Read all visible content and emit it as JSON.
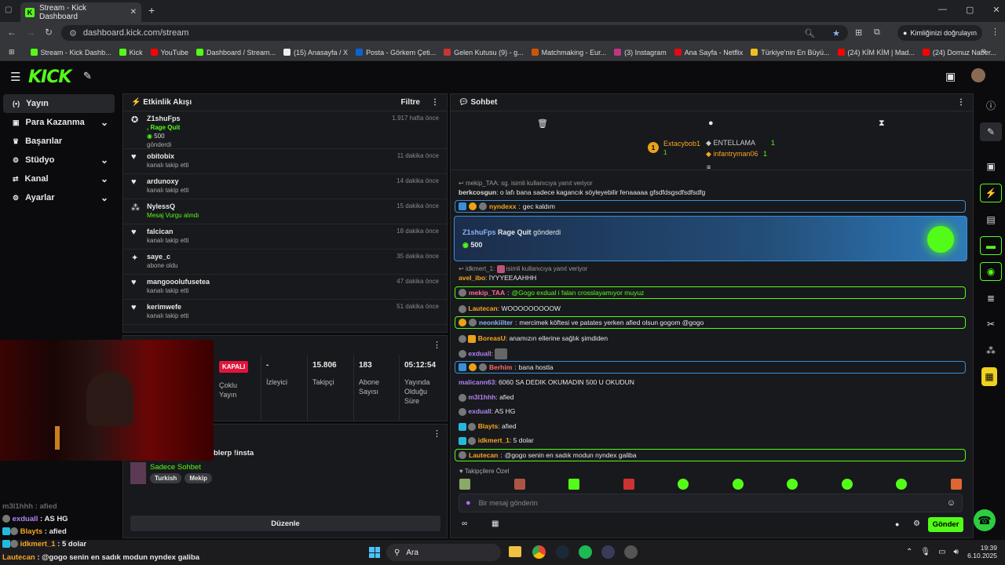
{
  "browser": {
    "tab_title": "Stream - Kick Dashboard",
    "url": "dashboard.kick.com/stream",
    "profile_label": "Kimliğinizi doğrulayın",
    "bookmarks": [
      {
        "label": "Stream - Kick Dashb...",
        "color": "#53fc18"
      },
      {
        "label": "Kick",
        "color": "#53fc18"
      },
      {
        "label": "YouTube",
        "color": "#ff0000"
      },
      {
        "label": "Dashboard / Stream...",
        "color": "#53fc18"
      },
      {
        "label": "(15) Anasayfa / X",
        "color": "#eeeeee"
      },
      {
        "label": "Posta - Görkem Çeti...",
        "color": "#0a64d6"
      },
      {
        "label": "Gelen Kutusu (9) - g...",
        "color": "#cc3333"
      },
      {
        "label": "Matchmaking - Eur...",
        "color": "#d35400"
      },
      {
        "label": "(3) Instagram",
        "color": "#c13584"
      },
      {
        "label": "Ana Sayfa - Netflix",
        "color": "#e50914"
      },
      {
        "label": "Türkiye'nin En Büyü...",
        "color": "#f0c020"
      },
      {
        "label": "(24) KİM KİM | Mad...",
        "color": "#ff0000"
      },
      {
        "label": "(24) Domuz Naber...",
        "color": "#ff0000"
      }
    ]
  },
  "sidebar": {
    "items": [
      {
        "label": "Yayın",
        "icon": "broadcast-icon",
        "glyph": "(•)",
        "chev": ""
      },
      {
        "label": "Para Kazanma",
        "icon": "money-icon",
        "glyph": "▣",
        "chev": "⌄"
      },
      {
        "label": "Başarılar",
        "icon": "trophy-icon",
        "glyph": "♛",
        "chev": ""
      },
      {
        "label": "Stüdyo",
        "icon": "studio-icon",
        "glyph": "⚙",
        "chev": "⌄"
      },
      {
        "label": "Kanal",
        "icon": "channel-icon",
        "glyph": "⇄",
        "chev": "⌄"
      },
      {
        "label": "Ayarlar",
        "icon": "settings-icon",
        "glyph": "⚙",
        "chev": "⌄"
      }
    ]
  },
  "activity": {
    "title": "Etkinlik Akışı",
    "filter": "Filtre",
    "events": [
      {
        "name": "Z1shuFps",
        "sub": "gönderdi",
        "time": "1.917 hafta önce",
        "icon": "kick-coin-icon"
      },
      {
        "name": "obitobix",
        "sub": "kanalı takip etti",
        "time": "11 dakika önce",
        "icon": "heart-icon"
      },
      {
        "name": "ardunoxy",
        "sub": "kanalı takip etti",
        "time": "14 dakika önce",
        "icon": "heart-icon"
      },
      {
        "name": "NylessQ",
        "sub": "Mesaj Vurgu alındı",
        "time": "15 dakika önce",
        "icon": "highlight-icon"
      },
      {
        "name": "falcican",
        "sub": "kanalı takip etti",
        "time": "18 dakika önce",
        "icon": "heart-icon"
      },
      {
        "name": "saye_c",
        "sub": "abone oldu",
        "time": "35 dakika önce",
        "icon": "star-icon"
      },
      {
        "name": "mangooolufusetea",
        "sub": "kanalı takip etti",
        "time": "47 dakika önce",
        "icon": "heart-icon"
      },
      {
        "name": "kerimwefe",
        "sub": "kanalı takip etti",
        "time": "51 dakika önce",
        "icon": "heart-icon"
      }
    ],
    "first_extra": ", Rage Quit",
    "first_amount": "500"
  },
  "stats": {
    "status": "KAPALI",
    "status_label": "Çoklu Yayın",
    "viewers_v": "-",
    "viewers_l": "İzleyici",
    "followers_v": "15.806",
    "followers_l": "Takipçi",
    "subs_v": "183",
    "subs_l": "Abone Sayısı",
    "uptime_v": "05:12:54",
    "uptime_l": "Yayında Olduğu Süre"
  },
  "info": {
    "title_fragment": "blerp !insta",
    "category": "Sadece Sohbet",
    "tags": [
      "Turkish",
      "Mekip"
    ],
    "edit_button": "Düzenle"
  },
  "chat": {
    "title": "Sohbet",
    "top1": "Extacybob1",
    "top1_count": "1",
    "top2": "ENTELLAMA",
    "top2_count": "1",
    "top3": "infantryman06",
    "top3_count": "1",
    "reply1": "mekip_TAA: sg. isimli kullanıcıya yanıt veriyor",
    "msg1_user": "berkcosgun",
    "msg1_text": "o lafı bana sadece kagancık söyleyebilir fenaaaaa gfsdfdsgsdfsdfsdfg",
    "msg2_user": "nyndexx",
    "msg2_text": "gec kaldım",
    "banner_user": "Z1shuFps",
    "banner_item": "Rage Quit",
    "banner_verb": "gönderdi",
    "banner_amount": "500",
    "reply2": "idkmert_1:",
    "reply2b": "isimli kullanıcıya yanıt veriyor",
    "msg3_user": "avel_ibo",
    "msg3_text": "İYYYEEAAHHH",
    "msg4_user": "mekip_TAA",
    "msg4_text": "@Gogo exdual i falan crosslayamıyor muyuz",
    "msg5_user": "Lautecan",
    "msg5_text": "WOOOOOOOOOW",
    "msg6_user": "neonkiilter",
    "msg6_text": "mercimek köftesi ve patates yerken afied olsun gogom @gogo",
    "msg7_user": "BoreasU",
    "msg7_text": "anamızın ellerine sağlık şimdiden",
    "msg8_user": "exduall",
    "msg8_text": "",
    "msg9_user": "Berhim",
    "msg9_text": "bana hostla",
    "msg10_user": "malicann63",
    "msg10_text": "6060 SA DEDIK OKUMADIN 500 U OKUDUN",
    "msg11_user": "m3l1hhh",
    "msg11_text": "afied",
    "msg12_user": "exduall",
    "msg12_text": "AS HG",
    "msg13_user": "Blayts",
    "msg13_text": "afied",
    "msg14_user": "idkmert_1",
    "msg14_text": "5 dolar",
    "msg15_user": "Lautecan",
    "msg15_text": "@gogo senin en sadık modun nyndex galiba",
    "followers_only": "Takipçilere Özel",
    "placeholder": "Bir mesaj gönderin",
    "send": "Gönder"
  },
  "overlay": {
    "l0": "m3l1hhh : afied",
    "l1u": "exduall",
    "l1t": " : AS HG",
    "l2u": "Blayts",
    "l2t": " : afied",
    "l3u": "idkmert_1",
    "l3t": " : 5 dolar",
    "l4u": "Lautecan",
    "l4t": " : @gogo senin en sadık modun nyndex galiba"
  },
  "taskbar": {
    "search": "Ara",
    "time": "19:39",
    "date": "6.10.2025"
  }
}
